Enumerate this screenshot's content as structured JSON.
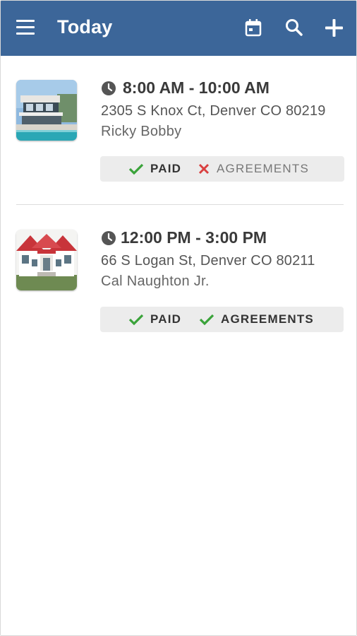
{
  "header": {
    "title": "Today",
    "icons": [
      "menu-icon",
      "calendar-icon",
      "search-icon",
      "plus-icon"
    ],
    "background": "#3c6699"
  },
  "appointments": [
    {
      "time": "8:00 AM - 10:00 AM",
      "address": "2305 S Knox Ct, Denver CO 80219",
      "client": "Ricky Bobby",
      "image": "modern-house-with-pool",
      "paid": {
        "label": "PAID",
        "status": "check"
      },
      "agreements": {
        "label": "AGREEMENTS",
        "status": "x"
      }
    },
    {
      "time": "12:00 PM - 3:00 PM",
      "address": "66 S Logan St, Denver CO 80211",
      "client": "Cal Naughton Jr.",
      "image": "white-house-red-roof",
      "paid": {
        "label": "PAID",
        "status": "check"
      },
      "agreements": {
        "label": "AGREEMENTS",
        "status": "check"
      }
    }
  ],
  "colors": {
    "check": "#3aa33a",
    "x": "#d94040"
  }
}
